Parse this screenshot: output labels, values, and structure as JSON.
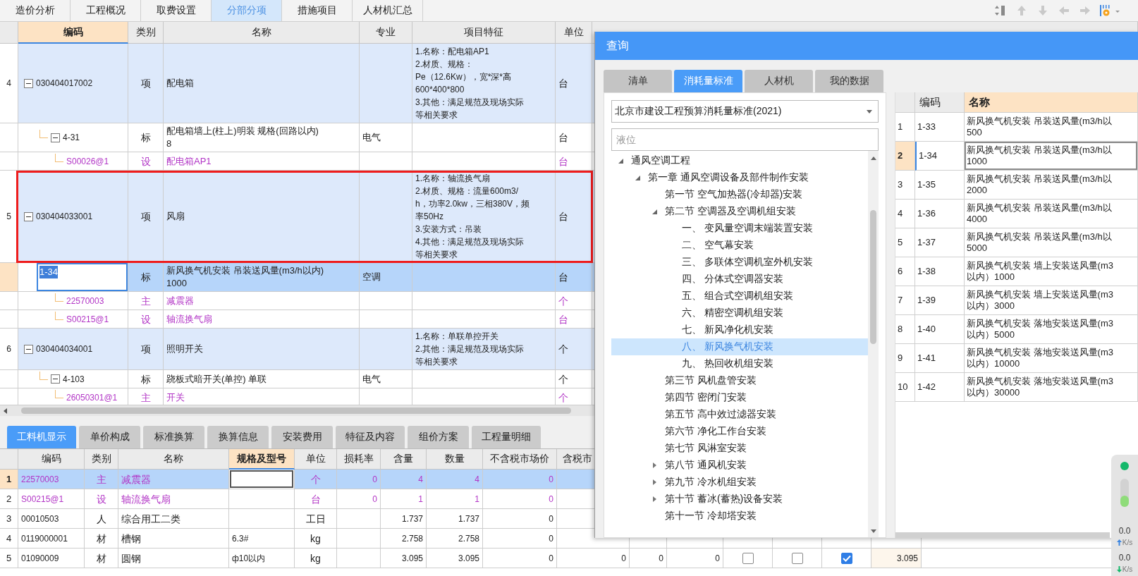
{
  "top_tabs": [
    {
      "label": "造价分析",
      "selected": false
    },
    {
      "label": "工程概况",
      "selected": false
    },
    {
      "label": "取费设置",
      "selected": false
    },
    {
      "label": "分部分项",
      "selected": true
    },
    {
      "label": "措施项目",
      "selected": false
    },
    {
      "label": "人材机汇总",
      "selected": false
    }
  ],
  "toolbar": [
    {
      "kind": "sort",
      "disabled": false
    },
    {
      "kind": "up",
      "disabled": true
    },
    {
      "kind": "down",
      "disabled": true
    },
    {
      "kind": "left",
      "disabled": true
    },
    {
      "kind": "right",
      "disabled": true
    },
    {
      "kind": "settings",
      "disabled": false
    }
  ],
  "main_grid": {
    "columns": [
      {
        "label": "编码",
        "selected": true
      },
      {
        "label": "类别",
        "selected": false
      },
      {
        "label": "名称",
        "selected": false
      },
      {
        "label": "专业",
        "selected": false
      },
      {
        "label": "项目特征",
        "selected": false
      },
      {
        "label": "单位",
        "selected": false
      }
    ],
    "rows": [
      {
        "no": "4",
        "kind": "bill",
        "code": "030404017002",
        "type": "项",
        "name": "配电箱",
        "features": [
          "1.名称：配电箱AP1",
          "2.材质、规格：",
          "Pe（12.6Kw），宽*深*高",
          "600*400*800",
          "3.其他：满足规范及现场实际",
          "等相关要求"
        ],
        "unit": "台",
        "expanded": true,
        "selected": false,
        "editing": false,
        "framed": false,
        "children": [
          {
            "kind": "quota",
            "code": "4-31",
            "type": "标",
            "name": "配电箱墙上(柱上)明装 规格(回路以内)\n8",
            "specialty": "电气",
            "unit": "台",
            "expanded": true,
            "selected": false,
            "editing": false,
            "framed": false,
            "children": [
              {
                "kind": "resource",
                "code": "S00026@1",
                "type": "设",
                "name": "配电箱AP1",
                "unit": "台",
                "selected": false,
                "editing": false,
                "framed": false
              }
            ]
          }
        ]
      },
      {
        "no": "5",
        "kind": "bill",
        "code": "030404033001",
        "type": "项",
        "name": "风扇",
        "features": [
          "1.名称：轴流换气扇",
          "2.材质、规格：流量600m3/",
          "h，功率2.0kw，三相380V，频",
          "率50Hz",
          "3.安装方式：吊装",
          "4.其他：满足规范及现场实际",
          "等相关要求"
        ],
        "unit": "台",
        "expanded": true,
        "selected": false,
        "editing": false,
        "framed": true,
        "children": [
          {
            "kind": "quota",
            "code": "1-34",
            "type": "标",
            "name": "新风换气机安装 吊装送风量(m3/h以内)\n1000",
            "specialty": "空调",
            "unit": "台",
            "selected": true,
            "editing": true,
            "framed": false,
            "children": [
              {
                "kind": "resource",
                "code": "22570003",
                "type": "主",
                "name": "减震器",
                "unit": "个",
                "selected": false,
                "editing": false,
                "framed": false
              },
              {
                "kind": "resource",
                "code": "S00215@1",
                "type": "设",
                "name": "轴流换气扇",
                "unit": "台",
                "selected": false,
                "editing": false,
                "framed": false
              }
            ]
          }
        ]
      },
      {
        "no": "6",
        "kind": "bill",
        "code": "030404034001",
        "type": "项",
        "name": "照明开关",
        "features": [
          "1.名称：单联单控开关",
          "2.其他：满足规范及现场实际",
          "等相关要求"
        ],
        "unit": "个",
        "expanded": true,
        "selected": false,
        "editing": false,
        "framed": false,
        "children": [
          {
            "kind": "quota",
            "code": "4-103",
            "type": "标",
            "name": "跷板式暗开关(单控) 单联",
            "specialty": "电气",
            "unit": "个",
            "expanded": true,
            "selected": false,
            "editing": false,
            "framed": false,
            "children": [
              {
                "kind": "resource",
                "code": "26050301@1",
                "type": "主",
                "name": "开关",
                "unit": "个",
                "selected": false,
                "editing": false,
                "framed": false
              }
            ]
          }
        ]
      }
    ]
  },
  "detail_tabs": [
    {
      "label": "工料机显示",
      "selected": true
    },
    {
      "label": "单价构成",
      "selected": false
    },
    {
      "label": "标准换算",
      "selected": false
    },
    {
      "label": "换算信息",
      "selected": false
    },
    {
      "label": "安装费用",
      "selected": false
    },
    {
      "label": "特征及内容",
      "selected": false
    },
    {
      "label": "组价方案",
      "selected": false
    },
    {
      "label": "工程量明细",
      "selected": false
    }
  ],
  "resource_grid": {
    "columns": [
      {
        "label": "编码",
        "selected": false
      },
      {
        "label": "类别",
        "selected": false
      },
      {
        "label": "名称",
        "selected": false
      },
      {
        "label": "规格及型号",
        "selected": true
      },
      {
        "label": "单位",
        "selected": false
      },
      {
        "label": "损耗率",
        "selected": false
      },
      {
        "label": "含量",
        "selected": false
      },
      {
        "label": "数量",
        "selected": false
      },
      {
        "label": "不含税市场价",
        "selected": false
      },
      {
        "label": "含税市",
        "selected": false
      }
    ],
    "rows": [
      {
        "no": "1",
        "kind": "main",
        "code": "22570003",
        "type": "主",
        "name": "减震器",
        "unit": "个",
        "loss": "0",
        "content": "4",
        "quantity": "4",
        "price": "0",
        "selected": true,
        "editing": true
      },
      {
        "no": "2",
        "kind": "main",
        "code": "S00215@1",
        "type": "设",
        "name": "轴流换气扇",
        "unit": "台",
        "loss": "0",
        "content": "1",
        "quantity": "1",
        "price": "0",
        "selected": false,
        "editing": false
      },
      {
        "no": "3",
        "kind": "plain",
        "code": "00010503",
        "type": "人",
        "name": "综合用工二类",
        "unit": "工日",
        "content": "1.737",
        "quantity": "1.737",
        "price": "0",
        "selected": false,
        "editing": false
      },
      {
        "no": "4",
        "kind": "plain",
        "code": "0119000001",
        "type": "材",
        "name": "槽钢",
        "spec": "6.3#",
        "unit": "kg",
        "content": "2.758",
        "quantity": "2.758",
        "price": "0",
        "selected": false,
        "editing": false
      },
      {
        "no": "5",
        "kind": "plain",
        "code": "01090009",
        "type": "材",
        "name": "圆钢",
        "spec": "ф10以内",
        "unit": "kg",
        "content": "3.095",
        "quantity": "3.095",
        "price": "0",
        "selected": false,
        "editing": false,
        "extra": [
          {
            "kind": "number",
            "value": "0"
          },
          {
            "kind": "number",
            "value": "0"
          },
          {
            "kind": "number",
            "value": "0"
          },
          {
            "kind": "check",
            "checked": false
          },
          {
            "kind": "check",
            "checked": false
          },
          {
            "kind": "check",
            "checked": true
          },
          {
            "kind": "total",
            "value": "3.095"
          }
        ]
      }
    ]
  },
  "dialog": {
    "title": "查询",
    "tabs": [
      {
        "label": "清单",
        "selected": false
      },
      {
        "label": "消耗量标准",
        "selected": true
      },
      {
        "label": "人材机",
        "selected": false
      },
      {
        "label": "我的数据",
        "selected": false
      }
    ],
    "library": "北京市建设工程预算消耗量标准(2021)",
    "search": {
      "placeholder": "液位"
    },
    "tree": [
      {
        "label": "通风空调工程",
        "kind": "folder",
        "expanded": true,
        "selected": false,
        "children": [
          {
            "label": "第一章 通风空调设备及部件制作安装",
            "kind": "folder",
            "expanded": true,
            "selected": false,
            "children": [
              {
                "label": "第一节 空气加热器(冷却器)安装",
                "kind": "leaf",
                "selected": false
              },
              {
                "label": "第二节 空调器及空调机组安装",
                "kind": "folder",
                "expanded": true,
                "selected": false,
                "children": [
                  {
                    "label": "一、  变风量空调末端装置安装",
                    "kind": "leaf",
                    "selected": false
                  },
                  {
                    "label": "二、  空气幕安装",
                    "kind": "leaf",
                    "selected": false
                  },
                  {
                    "label": "三、  多联体空调机室外机安装",
                    "kind": "leaf",
                    "selected": false
                  },
                  {
                    "label": "四、  分体式空调器安装",
                    "kind": "leaf",
                    "selected": false
                  },
                  {
                    "label": "五、  组合式空调机组安装",
                    "kind": "leaf",
                    "selected": false
                  },
                  {
                    "label": "六、  精密空调机组安装",
                    "kind": "leaf",
                    "selected": false
                  },
                  {
                    "label": "七、  新风净化机安装",
                    "kind": "leaf",
                    "selected": false
                  },
                  {
                    "label": "八、  新风换气机安装",
                    "kind": "leaf",
                    "selected": true
                  },
                  {
                    "label": "九、  热回收机组安装",
                    "kind": "leaf",
                    "selected": false
                  }
                ]
              },
              {
                "label": "第三节 风机盘管安装",
                "kind": "leaf",
                "selected": false
              },
              {
                "label": "第四节 密闭门安装",
                "kind": "leaf",
                "selected": false
              },
              {
                "label": "第五节 高中效过滤器安装",
                "kind": "leaf",
                "selected": false
              },
              {
                "label": "第六节 净化工作台安装",
                "kind": "leaf",
                "selected": false
              },
              {
                "label": "第七节 风淋室安装",
                "kind": "leaf",
                "selected": false
              },
              {
                "label": "第八节 通风机安装",
                "kind": "folder",
                "expanded": false,
                "selected": false
              },
              {
                "label": "第九节 冷水机组安装",
                "kind": "folder",
                "expanded": false,
                "selected": false
              },
              {
                "label": "第十节 蓄冰(蓄热)设备安装",
                "kind": "folder",
                "expanded": false,
                "selected": false
              },
              {
                "label": "第十一节 冷却塔安装",
                "kind": "leaf",
                "selected": false
              }
            ]
          }
        ]
      }
    ],
    "results": {
      "columns": [
        {
          "label": "编码",
          "selected": false
        },
        {
          "label": "名称",
          "selected": true
        }
      ],
      "rows": [
        {
          "no": "1",
          "code": "1-33",
          "name": "新风换气机安装 吊装送风量(m3/h以\n500",
          "selected": false
        },
        {
          "no": "2",
          "code": "1-34",
          "name": "新风换气机安装 吊装送风量(m3/h以\n1000",
          "selected": true
        },
        {
          "no": "3",
          "code": "1-35",
          "name": "新风换气机安装 吊装送风量(m3/h以\n2000",
          "selected": false
        },
        {
          "no": "4",
          "code": "1-36",
          "name": "新风换气机安装 吊装送风量(m3/h以\n4000",
          "selected": false
        },
        {
          "no": "5",
          "code": "1-37",
          "name": "新风换气机安装 吊装送风量(m3/h以\n5000",
          "selected": false
        },
        {
          "no": "6",
          "code": "1-38",
          "name": "新风换气机安装 墙上安装送风量(m3\n以内）1000",
          "selected": false
        },
        {
          "no": "7",
          "code": "1-39",
          "name": "新风换气机安装 墙上安装送风量(m3\n以内）3000",
          "selected": false
        },
        {
          "no": "8",
          "code": "1-40",
          "name": "新风换气机安装 落地安装送风量(m3\n以内）5000",
          "selected": false
        },
        {
          "no": "9",
          "code": "1-41",
          "name": "新风换气机安装 落地安装送风量(m3\n以内）10000",
          "selected": false
        },
        {
          "no": "10",
          "code": "1-42",
          "name": "新风换气机安装 落地安装送风量(m3\n以内）30000",
          "selected": false
        }
      ]
    }
  },
  "network": {
    "upload": {
      "rate": "0.0",
      "unit": "K/s"
    },
    "download": {
      "rate": "0.0",
      "unit": "K/s"
    }
  }
}
